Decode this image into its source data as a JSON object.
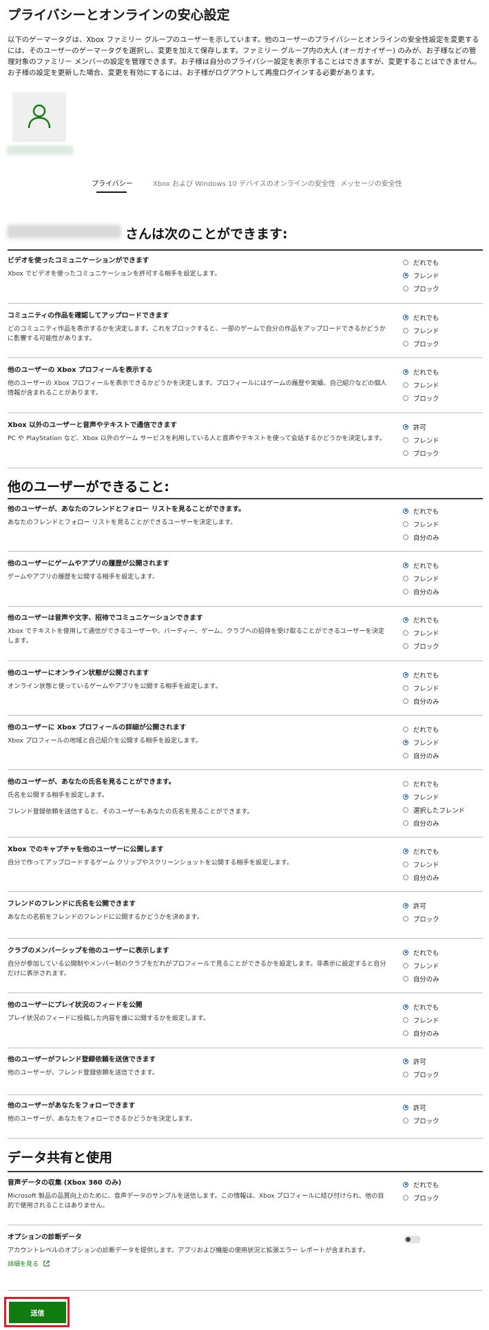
{
  "page_title": "プライバシーとオンラインの安心設定",
  "intro": "以下のゲーマータグは、Xbox ファミリー グループのユーザーを示しています。他のユーザーのプライバシーとオンラインの安全性設定を変更するには、そのユーザーのゲーマータグを選択し、変更を加えて保存します。ファミリー グループ内の大人 (オーガナイザー) のみが、お子様などの管理対象のファミリー メンバーの設定を管理できます。お子様は自分のプライバシー設定を表示することはできますが、変更することはできません。お子様の設定を更新した場合、変更を有効にするには、お子様がログアウトして再度ログインする必要があります。",
  "tabs": [
    "プライバシー",
    "Xbox および Windows 10 デバイスのオンラインの安全性",
    "メッセージの安全性"
  ],
  "sections": [
    {
      "title": "さんは次のことができます:"
    },
    {
      "title": "他のユーザーができること:"
    },
    {
      "title": "データ共有と使用"
    }
  ],
  "rows": [
    {
      "title": "ビデオを使ったコミュニケーションができます",
      "desc": [
        "Xbox でビデオを使ったコミュニケーションを許可する相手を設定します。"
      ],
      "options": [
        "だれでも",
        "フレンド",
        "ブロック"
      ],
      "selected": 1
    },
    {
      "title": "コミュニティの作品を確認してアップロードできます",
      "desc": [
        "どのコミュニティ作品を表示するかを決定します。これをブロックすると、一部のゲームで自分の作品をアップロードできるかどうかに影響する可能性があります。"
      ],
      "options": [
        "だれでも",
        "フレンド",
        "ブロック"
      ],
      "selected": 0
    },
    {
      "title": "他のユーザーの Xbox プロフィールを表示する",
      "desc": [
        "他のユーザーの Xbox プロフィールを表示できるかどうかを決定します。プロフィールにはゲームの履歴や実績、自己紹介などの個人情報が含まれることがあります。"
      ],
      "options": [
        "だれでも",
        "フレンド",
        "ブロック"
      ],
      "selected": 0
    },
    {
      "title": "Xbox 以外のユーザーと音声やテキストで通信できます",
      "desc": [
        "PC や PlayStation など、Xbox 以外のゲーム サービスを利用している人と音声やテキストを使って会話するかどうかを決定します。"
      ],
      "options": [
        "許可",
        "フレンド",
        "ブロック"
      ],
      "selected": 0
    },
    {
      "title": "他のユーザーが、あなたのフレンドとフォロー リストを見ることができます。",
      "desc": [
        "あなたのフレンドとフォロー リストを見ることができるユーザーを決定します。"
      ],
      "options": [
        "だれでも",
        "フレンド",
        "自分のみ"
      ],
      "selected": 0
    },
    {
      "title": "他のユーザーにゲームやアプリの履歴が公開されます",
      "desc": [
        "ゲームやアプリの履歴を公開する相手を設定します。"
      ],
      "options": [
        "だれでも",
        "フレンド",
        "自分のみ"
      ],
      "selected": 0
    },
    {
      "title": "他のユーザーは音声や文字、招待でコミュニケーションできます",
      "desc": [
        "Xbox でテキストを使用して通信ができるユーザーや、パーティー、ゲーム、クラブへの招待を受け取ることができるユーザーを決定します。"
      ],
      "options": [
        "だれでも",
        "フレンド",
        "ブロック"
      ],
      "selected": 0
    },
    {
      "title": "他のユーザーにオンライン状態が公開されます",
      "desc": [
        "オンライン状態と使っているゲームやアプリを公開する相手を設定します。"
      ],
      "options": [
        "だれでも",
        "フレンド",
        "自分のみ"
      ],
      "selected": 0
    },
    {
      "title": "他のユーザーに Xbox プロフィールの詳細が公開されます",
      "desc": [
        "Xbox プロフィールの地域と自己紹介を公開する相手を設定します。"
      ],
      "options": [
        "だれでも",
        "フレンド",
        "自分のみ"
      ],
      "selected": 1
    },
    {
      "title": "他のユーザーが、あなたの氏名を見ることができます。",
      "desc": [
        "氏名を公開する相手を設定します。",
        "フレンド登録依頼を送信すると、そのユーザーもあなたの氏名を見ることができます。"
      ],
      "options": [
        "だれでも",
        "フレンド",
        "選択したフレンド",
        "自分のみ"
      ],
      "selected": 1
    },
    {
      "title": "Xbox でのキャプチャを他のユーザーに公開します",
      "desc": [
        "自分で作ってアップロードするゲーム クリップやスクリーンショットを公開する相手を設定します。"
      ],
      "options": [
        "だれでも",
        "フレンド",
        "自分のみ"
      ],
      "selected": 0
    },
    {
      "title": "フレンドのフレンドに氏名を公開できます",
      "desc": [
        "あなたの名前をフレンドのフレンドに公開するかどうかを決めます。"
      ],
      "options": [
        "許可",
        "ブロック"
      ],
      "selected": 0
    },
    {
      "title": "クラブのメンバーシップを他のユーザーに表示します",
      "desc": [
        "自分が参加している公開制やメンバー制のクラブをだれがプロフィールで見ることができるかを設定します。非表示に設定すると自分だけに表示されます。"
      ],
      "options": [
        "だれでも",
        "フレンド",
        "自分のみ"
      ],
      "selected": 0
    },
    {
      "title": "他のユーザーにプレイ状況のフィードを公開",
      "desc": [
        "プレイ状況のフィードに投稿した内容を誰に公開するかを設定します。"
      ],
      "options": [
        "だれでも",
        "フレンド",
        "自分のみ"
      ],
      "selected": 0
    },
    {
      "title": "他のユーザーがフレンド登録依頼を送信できます",
      "desc": [
        "他のユーザーが、フレンド登録依頼を送信できます。"
      ],
      "options": [
        "許可",
        "ブロック"
      ],
      "selected": 0
    },
    {
      "title": "他のユーザーがあなたをフォローできます",
      "desc": [
        "他のユーザーが、あなたをフォローできるかどうかを決定します。"
      ],
      "options": [
        "許可",
        "ブロック"
      ],
      "selected": 0
    },
    {
      "title": "音声データの収集 (Xbox 360 のみ)",
      "desc": [
        "Microsoft 製品の品質向上のために、音声データのサンプルを送信します。この情報は、Xbox プロフィールに結び付けられ、他の目的で使用されることはありません。"
      ],
      "options": [
        "だれでも",
        "ブロック"
      ],
      "selected": 0
    },
    {
      "title": "オプションの診断データ",
      "desc": [
        "アカウントレベルのオプションの診断データを提供します。アプリおよび機能の使用状況と拡張エラー レポートが含まれます。"
      ],
      "options": [],
      "selected": -1
    }
  ],
  "diagnostics_toggle": {
    "on": false
  },
  "learn_more": "詳細を見る",
  "submit_label": "送信",
  "colors": {
    "accent": "#107c10",
    "radio": "#1d5fb8",
    "highlight": "#e21b23"
  }
}
